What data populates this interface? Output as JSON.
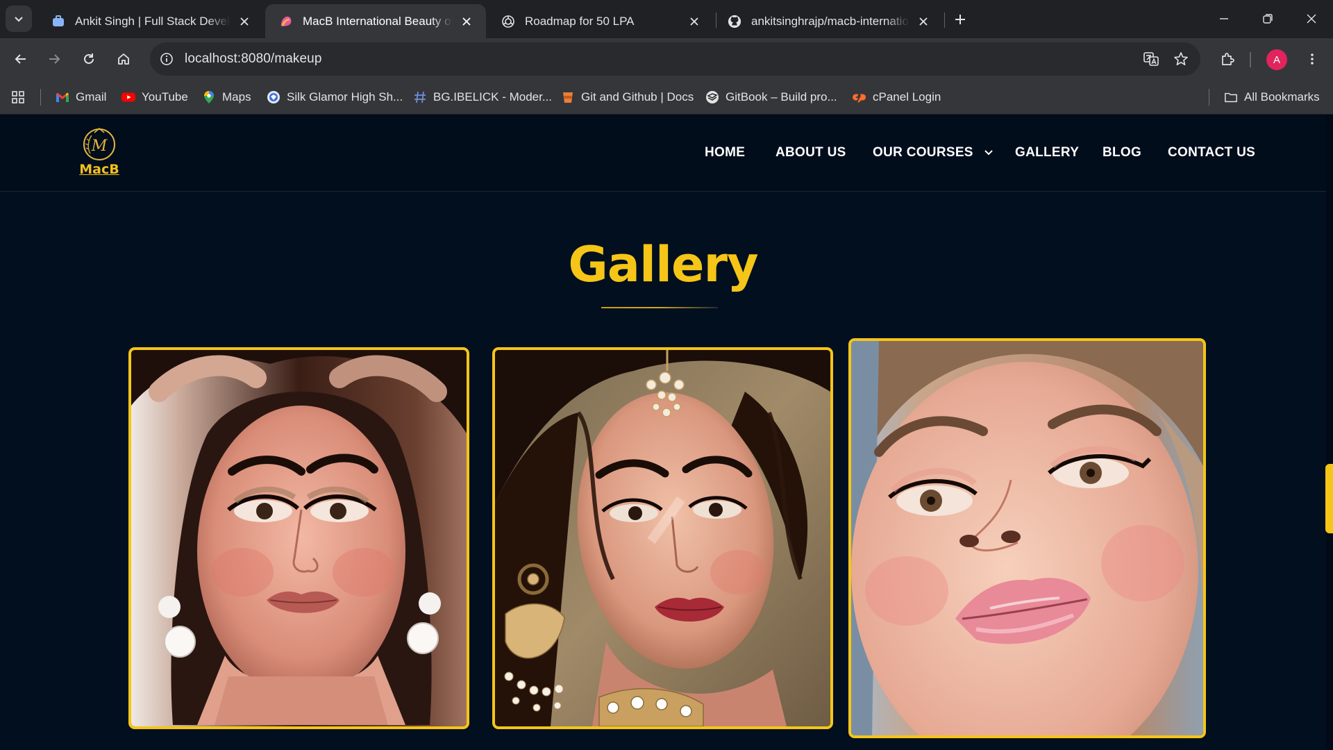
{
  "browser": {
    "tabs": [
      {
        "title": "Ankit Singh | Full Stack Developer",
        "active": false
      },
      {
        "title": "MacB International Beauty of School",
        "active": true
      },
      {
        "title": "Roadmap for 50 LPA",
        "active": false
      },
      {
        "title": "ankitsinghrajp/macb-international",
        "active": false
      }
    ],
    "url": "localhost:8080/makeup",
    "avatar_letter": "A",
    "bookmarks": [
      {
        "label": "Gmail"
      },
      {
        "label": "YouTube"
      },
      {
        "label": "Maps"
      },
      {
        "label": "Silk Glamor High Sh..."
      },
      {
        "label": "BG.IBELICK - Moder..."
      },
      {
        "label": "Git and Github | Docs"
      },
      {
        "label": "GitBook – Build pro..."
      },
      {
        "label": "cPanel Login"
      }
    ],
    "all_bookmarks_label": "All Bookmarks"
  },
  "site": {
    "logo_text": "MacB",
    "logo_letter": "M",
    "nav": {
      "home": "HOME",
      "about": "ABOUT US",
      "courses": "OUR COURSES",
      "gallery": "GALLERY",
      "blog": "BLOG",
      "contact": "CONTACT US"
    },
    "section_title": "Gallery"
  },
  "colors": {
    "accent": "#f5c518",
    "page_bg": "#010f1f"
  }
}
